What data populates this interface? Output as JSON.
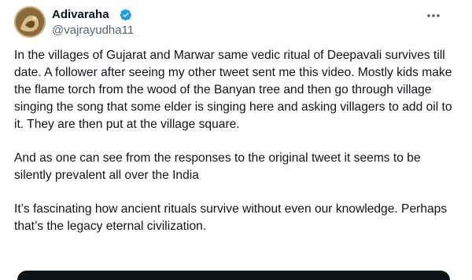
{
  "tweet": {
    "author": {
      "display_name": "Adivaraha",
      "handle": "@vajrayudha11",
      "verified": true,
      "avatar_icon": "profile-avatar"
    },
    "more_icon": "more-options-icon",
    "paragraphs": [
      "In the villages of Gujarat and Marwar same vedic ritual of Deepavali survives till date. A follower after seeing my other tweet sent me this video. Mostly kids make the flame torch from the wood of the Banyan tree and then go through village singing the song that some elder is singing here and asking villagers to add oil to it. They are then put at the village square.",
      "And as one can see from the responses to the original tweet it seems to be silently prevalent all over the India",
      "It’s fascinating how ancient rituals survive without even our knowledge. Perhaps that’s the legacy eternal civilization."
    ],
    "colors": {
      "text": "#0f1419",
      "secondary": "#536471",
      "verified": "#1d9bf0"
    }
  }
}
